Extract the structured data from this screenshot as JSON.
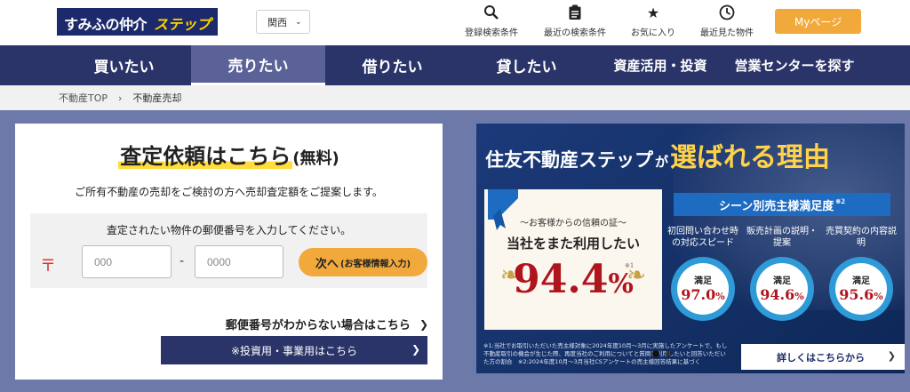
{
  "header": {
    "logo_part1": "すみふの仲介",
    "logo_part2": "ステップ",
    "region": "関西",
    "icons": [
      {
        "label": "登録検索条件",
        "icon": "search-icon"
      },
      {
        "label": "最近の検索条件",
        "icon": "clipboard-icon"
      },
      {
        "label": "お気に入り",
        "icon": "star-icon"
      },
      {
        "label": "最近見た物件",
        "icon": "clock-icon"
      }
    ],
    "mypage": "Myページ"
  },
  "nav": {
    "items": [
      {
        "label": "買いたい"
      },
      {
        "label": "売りたい"
      },
      {
        "label": "借りたい"
      },
      {
        "label": "貸したい"
      },
      {
        "label": "資産活用・投資"
      },
      {
        "label": "営業センターを探す"
      }
    ]
  },
  "breadcrumb": {
    "home": "不動産TOP",
    "current": "不動産売却"
  },
  "form": {
    "title": "査定依頼はこちら",
    "title_suffix": "(無料)",
    "subtitle": "ご所有不動産の売却をご検討の方へ売却査定額をご提案します。",
    "zip_prompt": "査定されたい物件の郵便番号を入力してください。",
    "zip_mark": "〒",
    "zip1_placeholder": "000",
    "zip2_placeholder": "0000",
    "dash": "-",
    "next_label": "次へ",
    "next_sub": "(お客様情報入力)",
    "unknown_zip": "郵便番号がわからない場合はこちら",
    "investment": "※投資用・事業用はこちら"
  },
  "banner": {
    "title_main": "住友不動産ステップ",
    "title_ga": "が",
    "title_em": "選ばれる理由",
    "card_sub": "〜お客様からの信頼の証〜",
    "card_head": "当社をまた利用したい",
    "card_pct": "94.4",
    "card_pct_unit": "%",
    "card_note": "※1",
    "scene_title": "シーン別売主様満足度",
    "scene_note": "※2",
    "scenes": [
      {
        "label": "初回問い合わせ時の対応スピード",
        "caption": "満足",
        "value": "97.0",
        "unit": "%"
      },
      {
        "label": "販売計画の説明・提案",
        "caption": "満足",
        "value": "94.6",
        "unit": "%"
      },
      {
        "label": "売買契約の内容説明",
        "caption": "満足",
        "value": "95.6",
        "unit": "%"
      }
    ],
    "footnote": "※1:当社でお取引いただいた売主様対象に2024年度10月〜3月に実施したアンケートで、もし不動産取引の機会が生じた際、再度当社のご利用についてと質問し利用したいと回答いただいた方の割合　※2:2024年度10月〜3月当社CSアンケートの売主様回答結果に基づく",
    "details": "詳しくはこちらから"
  }
}
